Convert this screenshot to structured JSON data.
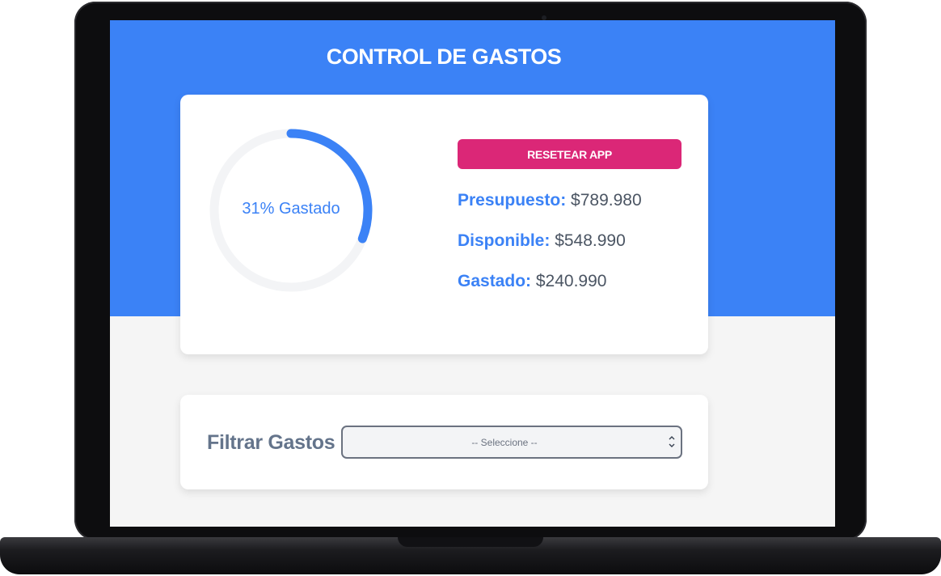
{
  "app": {
    "title": "CONTROL DE GASTOS"
  },
  "budget": {
    "progress_percent": 31,
    "progress_label": "31% Gastado",
    "reset_label": "RESETEAR APP",
    "budget_label": "Presupuesto:",
    "budget_value": "$789.980",
    "available_label": "Disponible:",
    "available_value": "$548.990",
    "spent_label": "Gastado:",
    "spent_value": "$240.990"
  },
  "filter": {
    "label": "Filtrar Gastos",
    "selected_option": "-- Seleccione --",
    "chevron_icon": "chevron-down-icon"
  },
  "colors": {
    "primary": "#3b82f6",
    "accent": "#db2777",
    "track": "#f3f4f6",
    "background": "#f5f5f5"
  }
}
